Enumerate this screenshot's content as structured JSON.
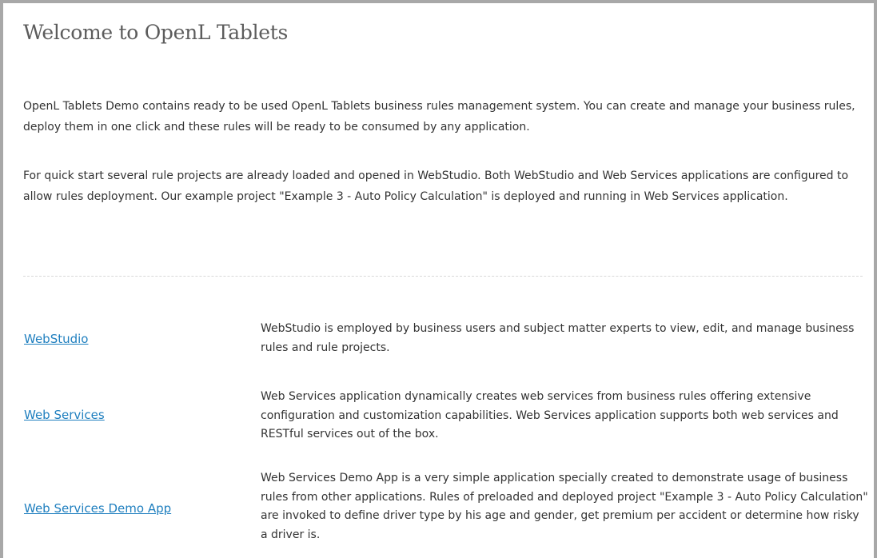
{
  "page": {
    "title": "Welcome to OpenL Tablets"
  },
  "intro": {
    "paragraph_1": "OpenL Tablets Demo contains ready to be used OpenL Tablets business rules management system. You can create and manage your business rules, deploy them in one click and these rules will be ready to be consumed by any application.",
    "paragraph_2": "For quick start several rule projects are already loaded and opened in WebStudio. Both WebStudio and Web Services applications are configured to allow rules deployment. Our example project \"Example 3 - Auto Policy Calculation\" is deployed and running in Web Services application."
  },
  "apps": [
    {
      "link_label": "WebStudio",
      "description": "WebStudio is employed by business users and subject matter experts to view, edit, and manage business rules and rule projects."
    },
    {
      "link_label": "Web Services",
      "description": "Web Services application dynamically creates web services from business rules offering extensive configuration and customization capabilities. Web Services application supports both web services and RESTful services out of the box."
    },
    {
      "link_label": "Web Services Demo App",
      "description": "Web Services Demo App is a very simple application specially created to demonstrate usage of business rules from other applications. Rules of preloaded and deployed project \"Example 3 - Auto Policy Calculation\" are invoked to define driver type by his age and gender, get premium per accident or determine how risky a driver is."
    }
  ],
  "colors": {
    "link": "#1f7fbf",
    "frame_border": "#a8a8a8",
    "title_text": "#5c5c5c",
    "body_text": "#333333"
  }
}
